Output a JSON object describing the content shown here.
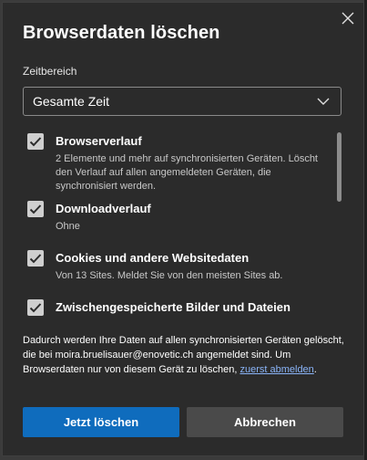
{
  "dialog": {
    "title": "Browserdaten löschen",
    "close_icon": "close-icon"
  },
  "time_range": {
    "label": "Zeitbereich",
    "selected": "Gesamte Zeit"
  },
  "items": [
    {
      "title": "Browserverlauf",
      "checked": true,
      "description": "2 Elemente und mehr auf synchronisierten Geräten. Löscht den Verlauf auf allen angemeldeten Geräten, die synchronisiert werden."
    },
    {
      "title": "Downloadverlauf",
      "checked": true,
      "description": "Ohne"
    },
    {
      "title": "Cookies und andere Websitedaten",
      "checked": true,
      "description": "Von 13 Sites. Meldet Sie von den meisten Sites ab."
    },
    {
      "title": "Zwischengespeicherte Bilder und Dateien",
      "checked": true,
      "description": ""
    }
  ],
  "notice": {
    "text": "Dadurch werden Ihre Daten auf allen synchronisierten Geräten gelöscht, die bei moira.bruelisauer@enovetic.ch angemeldet sind. Um Browserdaten nur von diesem Gerät zu löschen, ",
    "link": "zuerst abmelden",
    "end": "."
  },
  "buttons": {
    "confirm": "Jetzt löschen",
    "cancel": "Abbrechen"
  },
  "colors": {
    "primary": "#0f6cbd",
    "link": "#8ab4f8",
    "background": "#2b2b2b"
  }
}
